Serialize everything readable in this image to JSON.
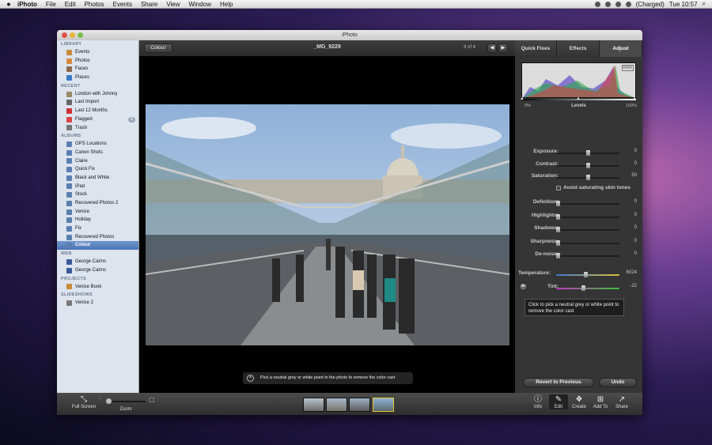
{
  "menubar": {
    "apple": "",
    "app": "iPhoto",
    "items": [
      "File",
      "Edit",
      "Photos",
      "Events",
      "Share",
      "View",
      "Window",
      "Help"
    ],
    "battery": "(Charged)",
    "clock": "Tue 10:57"
  },
  "window": {
    "title": "iPhoto"
  },
  "sidebar": {
    "sections": [
      {
        "title": "LIBRARY",
        "items": [
          {
            "label": "Events",
            "color": "#c98a3a"
          },
          {
            "label": "Photos",
            "color": "#d68a3a"
          },
          {
            "label": "Faces",
            "color": "#8a6a4a"
          },
          {
            "label": "Places",
            "color": "#3b7ac9"
          }
        ]
      },
      {
        "title": "RECENT",
        "items": [
          {
            "label": "London with Johnny",
            "color": "#9a8a6a"
          },
          {
            "label": "Last Import",
            "color": "#666"
          },
          {
            "label": "Last 12 Months",
            "color": "#c33"
          },
          {
            "label": "Flagged",
            "color": "#d44",
            "badge": "6"
          },
          {
            "label": "Trash",
            "color": "#777"
          }
        ]
      },
      {
        "title": "ALBUMS",
        "items": [
          {
            "label": "GPS Locations",
            "color": "#5a7fb0"
          },
          {
            "label": "Canon Shots",
            "color": "#5a7fb0"
          },
          {
            "label": "Claire",
            "color": "#5a7fb0"
          },
          {
            "label": "Quick Fix",
            "color": "#5a7fb0"
          },
          {
            "label": "Black and White",
            "color": "#5a7fb0"
          },
          {
            "label": "iPad",
            "color": "#5a7fb0"
          },
          {
            "label": "Stock",
            "color": "#5a7fb0"
          },
          {
            "label": "Recovered Photos 2",
            "color": "#5a7fb0"
          },
          {
            "label": "Venice",
            "color": "#5a7fb0"
          },
          {
            "label": "Holiday",
            "color": "#5a7fb0"
          },
          {
            "label": "Fix",
            "color": "#5a7fb0"
          },
          {
            "label": "Recovered Photos",
            "color": "#5a7fb0"
          },
          {
            "label": "Colour",
            "color": "#5a7fb0",
            "selected": true
          }
        ]
      },
      {
        "title": "WEB",
        "items": [
          {
            "label": "George Cairns",
            "color": "#3b5998"
          },
          {
            "label": "George Cairns",
            "color": "#3b5998"
          }
        ]
      },
      {
        "title": "PROJECTS",
        "items": [
          {
            "label": "Venice Book",
            "color": "#c98a3a"
          }
        ]
      },
      {
        "title": "SLIDESHOWS",
        "items": [
          {
            "label": "Venice 2",
            "color": "#777"
          }
        ]
      }
    ]
  },
  "viewer": {
    "back_label": "Colour",
    "photo_name": "_MG_9229",
    "counter": "4 of 4",
    "hint": "Pick a neutral grey or white point in the photo to remove the color cast"
  },
  "adjust": {
    "tabs": [
      "Quick Fixes",
      "Effects",
      "Adjust"
    ],
    "levels": {
      "label": "Levels",
      "min": "0%",
      "max": "100%",
      "raw": "RAW"
    },
    "sliders1": [
      {
        "label": "Exposure:",
        "value": "0",
        "pos": 0.5
      },
      {
        "label": "Contrast:",
        "value": "0",
        "pos": 0.5
      },
      {
        "label": "Saturation:",
        "value": "50",
        "pos": 0.5
      }
    ],
    "skin_tones": "Avoid saturating skin tones",
    "sliders2": [
      {
        "label": "Definition:",
        "value": "0",
        "pos": 0.0
      },
      {
        "label": "Highlights:",
        "value": "0",
        "pos": 0.0
      },
      {
        "label": "Shadows:",
        "value": "0",
        "pos": 0.0
      },
      {
        "label": "Sharpness:",
        "value": "0",
        "pos": 0.0
      },
      {
        "label": "De-noise:",
        "value": "0",
        "pos": 0.0
      }
    ],
    "temperature": {
      "label": "Temperature:",
      "value": "6024",
      "pos": 0.47
    },
    "tint": {
      "label": "Tint:",
      "value": "-22",
      "pos": 0.43
    },
    "tooltip": "Click to pick a neutral grey or white point to remove the color cast",
    "revert": "Revert to Previous",
    "undo": "Undo"
  },
  "bottom": {
    "fullscreen": "Full Screen",
    "zoom": "Zoom",
    "buttons": [
      {
        "label": "Info",
        "glyph": "ⓘ"
      },
      {
        "label": "Edit",
        "glyph": "✎"
      },
      {
        "label": "Create",
        "glyph": "❖"
      },
      {
        "label": "Add To",
        "glyph": "⊞"
      },
      {
        "label": "Share",
        "glyph": "↗"
      }
    ]
  }
}
